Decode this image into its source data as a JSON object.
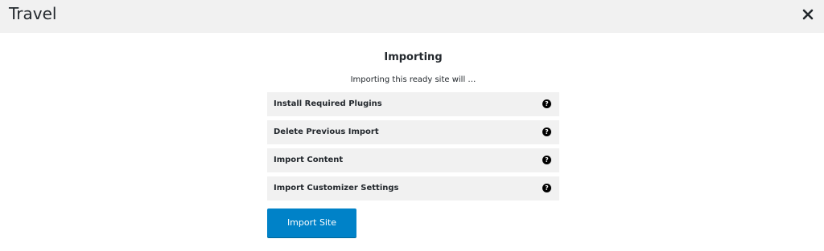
{
  "header": {
    "title": "Travel",
    "close_icon": "close-icon"
  },
  "main": {
    "heading": "Importing",
    "subheading": "Importing this ready site will …",
    "options": [
      {
        "label": "Install Required Plugins",
        "help_icon": "?"
      },
      {
        "label": "Delete Previous Import",
        "help_icon": "?"
      },
      {
        "label": "Import Content",
        "help_icon": "?"
      },
      {
        "label": "Import Customizer Settings",
        "help_icon": "?"
      }
    ],
    "import_button_label": "Import Site"
  },
  "colors": {
    "topbar_bg": "#f1f1f1",
    "row_bg": "#f1f1f1",
    "button_bg": "#0082c8",
    "text": "#23282d"
  }
}
